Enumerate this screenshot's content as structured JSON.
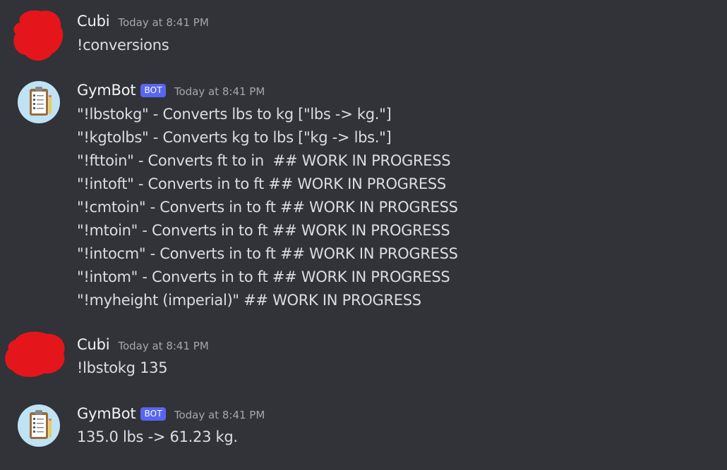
{
  "messages": [
    {
      "author": "Cubi",
      "timestamp": "Today at 8:41 PM",
      "is_bot": false,
      "lines": [
        "!conversions"
      ]
    },
    {
      "author": "GymBot",
      "badge": "BOT",
      "timestamp": "Today at 8:41 PM",
      "is_bot": true,
      "avatar_icon": "clipboard-icon",
      "lines": [
        "\"!lbstokg\" - Converts lbs to kg [\"lbs -> kg.\"]",
        "\"!kgtolbs\" - Converts kg to lbs [\"kg -> lbs.\"]",
        "\"!fttoin\" - Converts ft to in  ## WORK IN PROGRESS",
        "\"!intoft\" - Converts in to ft ## WORK IN PROGRESS",
        "\"!cmtoin\" - Converts in to ft ## WORK IN PROGRESS",
        "\"!mtoin\" - Converts in to ft ## WORK IN PROGRESS",
        "\"!intocm\" - Converts in to ft ## WORK IN PROGRESS",
        "\"!intom\" - Converts in to ft ## WORK IN PROGRESS",
        "\"!myheight (imperial)\" ## WORK IN PROGRESS"
      ]
    },
    {
      "author": "Cubi",
      "timestamp": "Today at 8:41 PM",
      "is_bot": false,
      "lines": [
        "!lbstokg 135"
      ]
    },
    {
      "author": "GymBot",
      "badge": "BOT",
      "timestamp": "Today at 8:41 PM",
      "is_bot": true,
      "avatar_icon": "clipboard-icon",
      "lines": [
        "135.0 lbs -> 61.23 kg."
      ]
    }
  ],
  "colors": {
    "background": "#313338",
    "text": "#dbdee1",
    "username": "#f2f3f5",
    "timestamp": "#a4a7ad",
    "bot_badge": "#5865f2",
    "redaction": "#e4161b"
  }
}
